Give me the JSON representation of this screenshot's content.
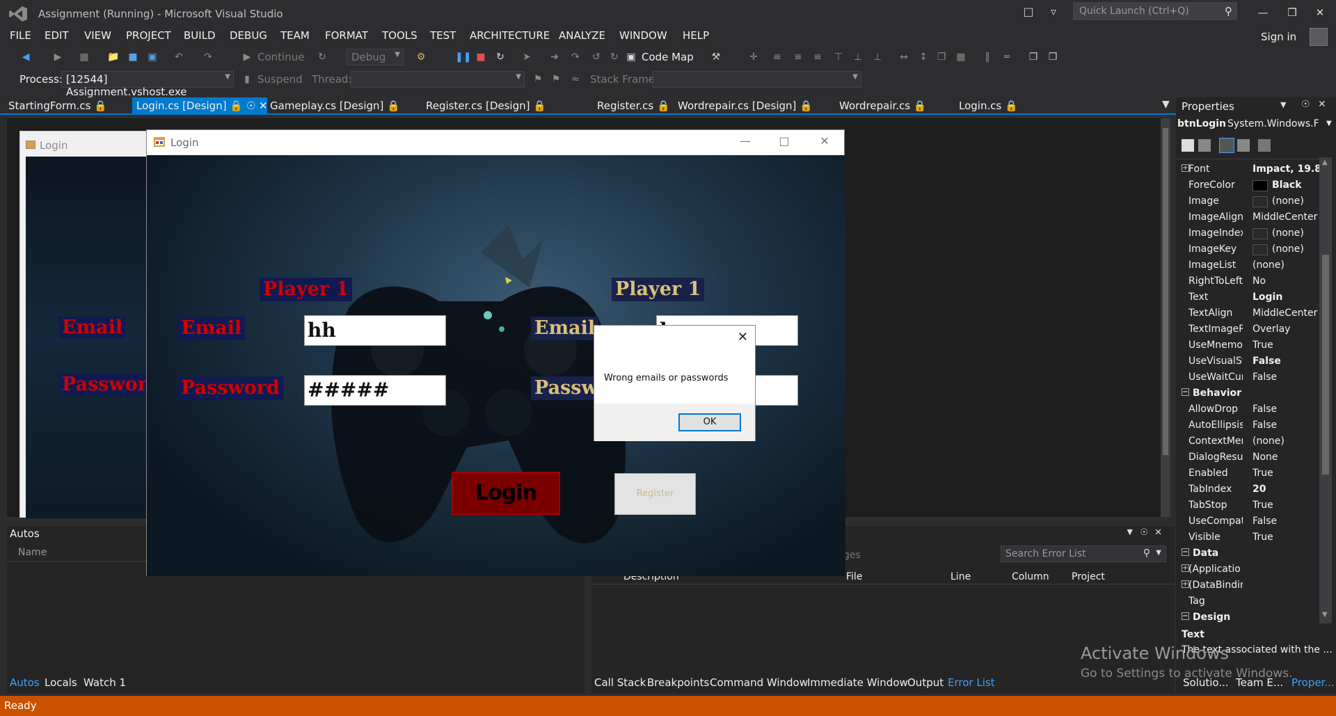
{
  "app": {
    "title": "Assignment (Running) - Microsoft Visual Studio",
    "quick_launch_placeholder": "Quick Launch (Ctrl+Q)",
    "sign_in": "Sign in"
  },
  "menu": [
    "FILE",
    "EDIT",
    "VIEW",
    "PROJECT",
    "BUILD",
    "DEBUG",
    "TEAM",
    "FORMAT",
    "TOOLS",
    "TEST",
    "ARCHITECTURE",
    "ANALYZE",
    "WINDOW",
    "HELP"
  ],
  "toolbar": {
    "continue": "Continue",
    "config": "Debug",
    "code_map": "Code Map",
    "process_label": "Process:",
    "process_value": "[12544] Assignment.vshost.exe",
    "suspend": "Suspend",
    "thread_label": "Thread:",
    "stack_frame_label": "Stack Frame:"
  },
  "doc_tabs": [
    {
      "label": "StartingForm.cs",
      "active": false
    },
    {
      "label": "Login.cs [Design]",
      "active": true
    },
    {
      "label": "Gameplay.cs [Design]",
      "active": false
    },
    {
      "label": "Register.cs [Design]",
      "active": false
    },
    {
      "label": "Register.cs",
      "active": false
    },
    {
      "label": "Wordrepair.cs [Design]",
      "active": false
    },
    {
      "label": "Wordrepair.cs",
      "active": false
    },
    {
      "label": "Login.cs",
      "active": false
    }
  ],
  "designer_form": {
    "title": "Login",
    "email": "Email",
    "password": "Password"
  },
  "login_window": {
    "title": "Login",
    "player1_left": "Player 1",
    "player1_right": "Player 1",
    "email_left": "Email",
    "password_left": "Password",
    "email_right": "Email",
    "password_right": "Passw",
    "email_value_left": "hh",
    "password_value_left": "#####",
    "email_value_right": "h",
    "login_button": "Login",
    "register_button": "Register"
  },
  "message_box": {
    "message": "Wrong emails or passwords",
    "ok": "OK"
  },
  "autos": {
    "title": "Autos",
    "col_name": "Name",
    "tabs": [
      "Autos",
      "Locals",
      "Watch 1"
    ]
  },
  "error_list": {
    "search_placeholder": "Search Error List",
    "partial_label": "ges",
    "columns": [
      "Description",
      "File",
      "Line",
      "Column",
      "Project"
    ],
    "tabs": [
      "Call Stack",
      "Breakpoints",
      "Command Window",
      "Immediate Window",
      "Output",
      "Error List"
    ]
  },
  "properties": {
    "title": "Properties",
    "object": "btnLogin",
    "object_type": "System.Windows.F",
    "rows": [
      {
        "type": "prop",
        "name": "Font",
        "value": "Impact, 19.8",
        "bold": true,
        "expand": true
      },
      {
        "type": "prop",
        "name": "ForeColor",
        "value": "Black",
        "bold": true,
        "swatch": "#000000"
      },
      {
        "type": "prop",
        "name": "Image",
        "value": "(none)",
        "swatch": "#2a2a2a"
      },
      {
        "type": "prop",
        "name": "ImageAlign",
        "value": "MiddleCenter"
      },
      {
        "type": "prop",
        "name": "ImageIndex",
        "value": "(none)",
        "swatch": "#2a2a2a"
      },
      {
        "type": "prop",
        "name": "ImageKey",
        "value": "(none)",
        "swatch": "#2a2a2a"
      },
      {
        "type": "prop",
        "name": "ImageList",
        "value": "(none)"
      },
      {
        "type": "prop",
        "name": "RightToLeft",
        "value": "No"
      },
      {
        "type": "prop",
        "name": "Text",
        "value": "Login",
        "bold": true
      },
      {
        "type": "prop",
        "name": "TextAlign",
        "value": "MiddleCenter"
      },
      {
        "type": "prop",
        "name": "TextImageR",
        "value": "Overlay"
      },
      {
        "type": "prop",
        "name": "UseMnemoi",
        "value": "True"
      },
      {
        "type": "prop",
        "name": "UseVisualSty",
        "value": "False",
        "bold": true
      },
      {
        "type": "prop",
        "name": "UseWaitCur",
        "value": "False"
      },
      {
        "type": "cat",
        "name": "Behavior"
      },
      {
        "type": "prop",
        "name": "AllowDrop",
        "value": "False"
      },
      {
        "type": "prop",
        "name": "AutoEllipsis",
        "value": "False"
      },
      {
        "type": "prop",
        "name": "ContextMen",
        "value": "(none)"
      },
      {
        "type": "prop",
        "name": "DialogResul",
        "value": "None"
      },
      {
        "type": "prop",
        "name": "Enabled",
        "value": "True"
      },
      {
        "type": "prop",
        "name": "TabIndex",
        "value": "20",
        "bold": true
      },
      {
        "type": "prop",
        "name": "TabStop",
        "value": "True"
      },
      {
        "type": "prop",
        "name": "UseCompat",
        "value": "False"
      },
      {
        "type": "prop",
        "name": "Visible",
        "value": "True"
      },
      {
        "type": "cat",
        "name": "Data"
      },
      {
        "type": "prop",
        "name": "(Applicatio",
        "value": "",
        "expand": true
      },
      {
        "type": "prop",
        "name": "(DataBindin",
        "value": "",
        "expand": true
      },
      {
        "type": "prop",
        "name": "Tag",
        "value": ""
      },
      {
        "type": "cat",
        "name": "Design"
      }
    ],
    "desc_title": "Text",
    "desc_text": "The text associated with the ...",
    "bottom_tabs": [
      "Solutio...",
      "Team E...",
      "Proper..."
    ]
  },
  "watermark": {
    "line1": "Activate Windows",
    "line2": "Go to Settings to activate Windows."
  },
  "status": "Ready",
  "colors": {
    "accent": "#007acc",
    "status_bar": "#ca5100",
    "login_button": "#7a0000"
  }
}
